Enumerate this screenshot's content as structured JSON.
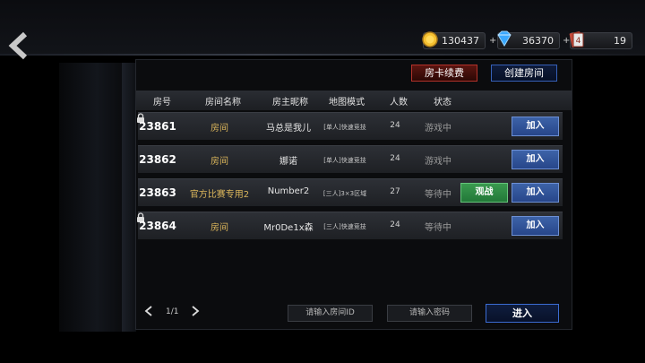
{
  "header": {
    "resources": [
      {
        "name": "coin",
        "value": "130437",
        "icon": "gold-coin-icon",
        "color": "#f5c030"
      },
      {
        "name": "diamond",
        "value": "36370",
        "icon": "diamond-icon",
        "color": "#3aa8ff"
      },
      {
        "name": "ticket",
        "value": "19",
        "icon": "card-icon",
        "color": "#c24a3a"
      }
    ],
    "renew_label": "房卡续费",
    "create_label": "创建房间"
  },
  "table": {
    "columns": [
      "房号",
      "房间名称",
      "房主昵称",
      "地图模式",
      "人数",
      "状态"
    ],
    "rows": [
      {
        "id": "23861",
        "name": "房间",
        "owner": "马总是我儿",
        "mode": "[单人]快速竞技",
        "count": "24",
        "status": "游戏中",
        "locked": true
      },
      {
        "id": "23862",
        "name": "房间",
        "owner": "娜诺",
        "mode": "[单人]快速竞技",
        "count": "24",
        "status": "游戏中",
        "locked": false
      },
      {
        "id": "23863",
        "name": "官方比赛专用2",
        "owner": "Number2",
        "mode": "[三人]3×3区域",
        "count": "27",
        "status": "等待中",
        "locked": false,
        "watch": "观战"
      },
      {
        "id": "23864",
        "name": "房间",
        "owner": "Mr0De1x森",
        "mode": "[三人]快速竞技",
        "count": "24",
        "status": "等待中",
        "locked": true
      }
    ],
    "join_label": "加入"
  },
  "footer": {
    "page": "1/1",
    "room_id_placeholder": "请输入房间ID",
    "password_placeholder": "请输入密码",
    "enter_label": "进入"
  },
  "colors": {
    "accent_blue": "#3b6cd2",
    "accent_red": "#b2322a",
    "watch_green": "#3a9a4f",
    "room_name": "#d9b45a"
  }
}
